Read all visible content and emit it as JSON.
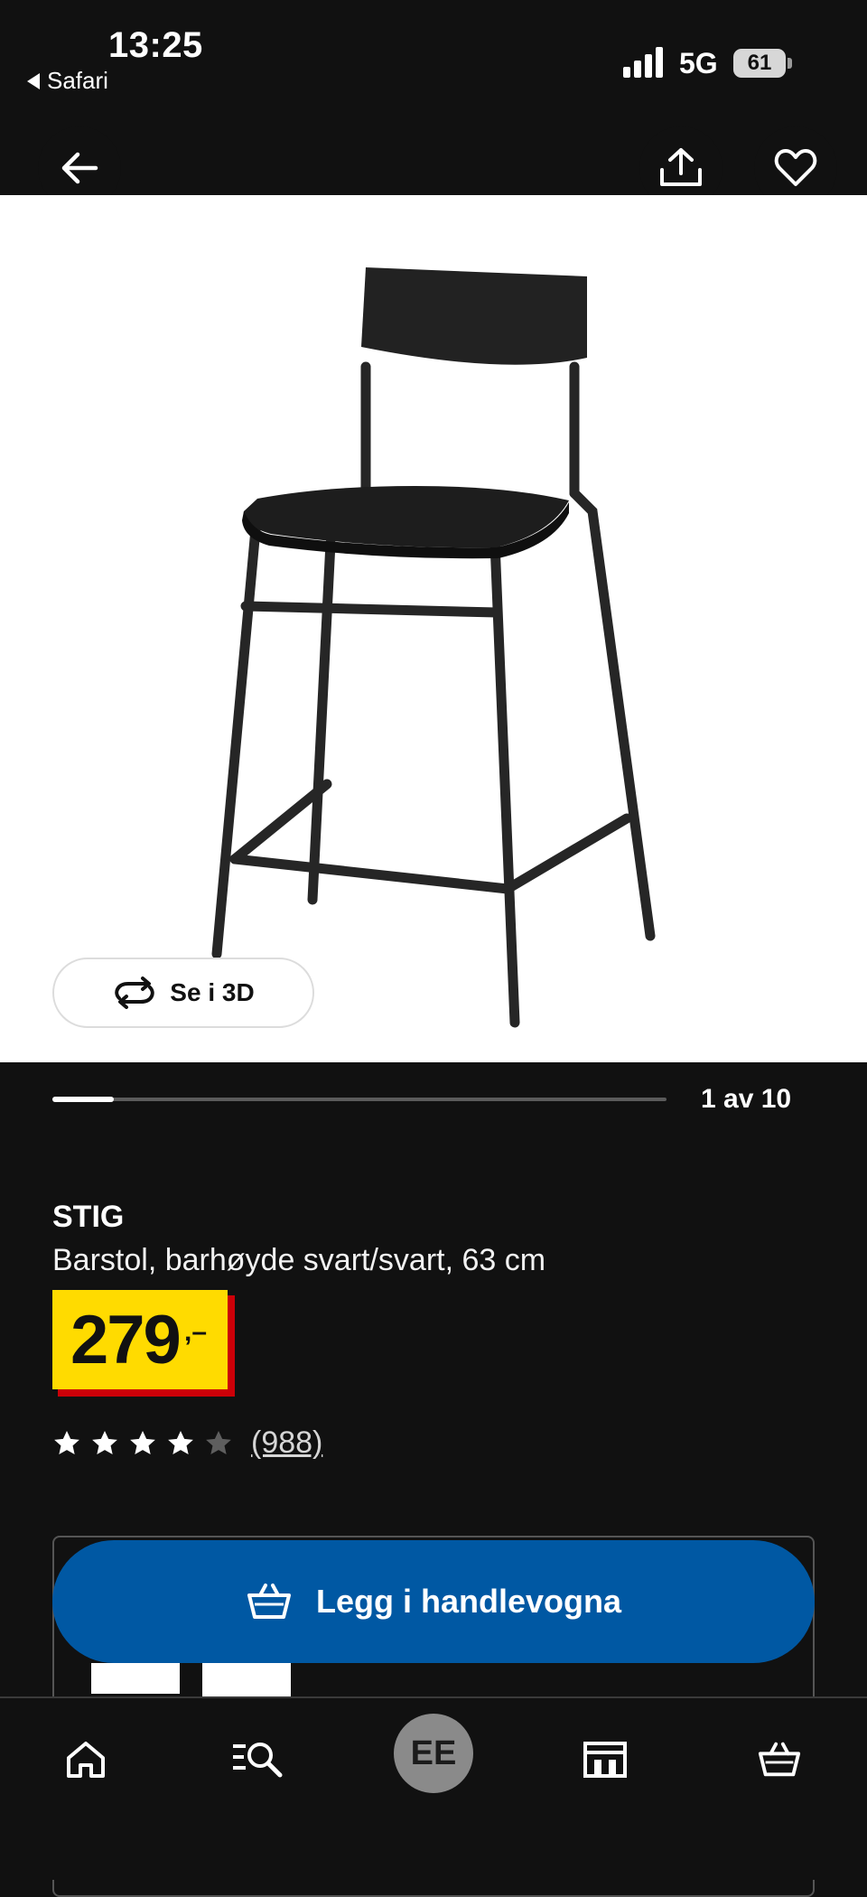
{
  "status_bar": {
    "time": "13:25",
    "back_app": "Safari",
    "network": "5G",
    "battery": "61"
  },
  "image": {
    "view_3d_label": "Se i 3D",
    "page_indicator": "1 av 10",
    "progress": 0.1
  },
  "product": {
    "name": "STIG",
    "description": "Barstol, barhøyde svart/svart, 63 cm",
    "price": "279",
    "price_suffix": ",–",
    "rating": 4,
    "rating_max": 5,
    "review_count": "(988)"
  },
  "cta": {
    "add_to_cart_label": "Legg i handlevogna"
  },
  "tab_bar": {
    "profile_initials": "EE"
  },
  "colors": {
    "background": "#111111",
    "price_yellow": "#ffdb00",
    "price_red": "#cc0008",
    "cta_blue": "#0058a3"
  },
  "icons": [
    "arrow-left-icon",
    "share-icon",
    "heart-icon",
    "rotate-3d-icon",
    "star-icon",
    "cart-icon",
    "home-icon",
    "search-icon",
    "store-icon"
  ]
}
